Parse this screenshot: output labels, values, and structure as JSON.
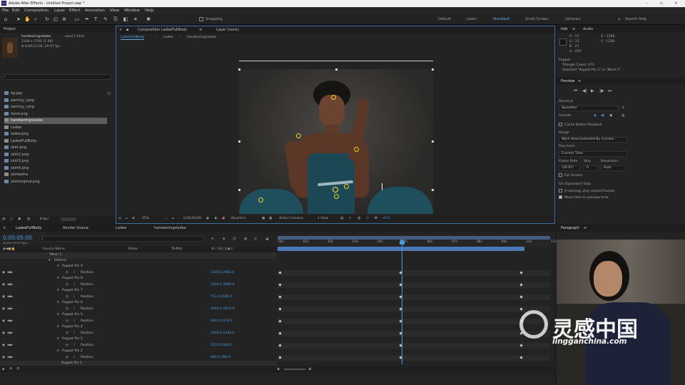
{
  "window": {
    "title": "Adobe After Effects - Untitled Project.aep *"
  },
  "menu": [
    "File",
    "Edit",
    "Composition",
    "Layer",
    "Effect",
    "Animation",
    "View",
    "Window",
    "Help"
  ],
  "toolbar": {
    "snapping": "Snapping",
    "workspaces": [
      "Default",
      "Learn",
      "Standard",
      "Small Screen",
      "Libraries"
    ],
    "search": "Search Help"
  },
  "project": {
    "tab": "Project",
    "selected_name": "handeeringsladee",
    "selected_used": ", used 1 time",
    "selected_size": "2160 x 2700 (1.00)",
    "selected_duration": "Δ 0;00;11;00, 29.97 fps",
    "files": [
      "bg.jpg",
      "earring_l.png",
      "earring_r.png",
      "hend.png",
      "handeeringsladee",
      "Ladee",
      "ladee.png",
      "LadeeFullBody",
      "skirt.png",
      "skirt2.png",
      "skirt3.png",
      "skirt4.png",
      "skirtextra",
      "skirtoriginal.png"
    ],
    "bpc": "8 bpc"
  },
  "composition": {
    "tab": "Composition LadeeFullBody",
    "layer_tab": "Layer (none)",
    "breadcrumbs": [
      "LadeeFullBody",
      "Ladee",
      "handeeringsladee"
    ],
    "zoom": "25%",
    "timecode": "0;00;05;00",
    "resolution": "(Quarter)",
    "camera": "Active Camera",
    "views": "1 View",
    "exposure": "+0.0"
  },
  "info": {
    "tab": "Info",
    "audio_tab": "Audio",
    "r": "R : 17",
    "g": "G : 21",
    "b": "B : 27",
    "a": "A : 255",
    "x": "X : 1184",
    "y": "Y : 1228",
    "puppet_title": "Puppet",
    "triangle": "Triangle Count: 672",
    "selected": "Selected \"Puppet Pin 1\" in \"Mesh 1\""
  },
  "preview": {
    "tab": "Preview",
    "shortcut_label": "Shortcut",
    "shortcut_value": "Spacebar",
    "include_label": "Include:",
    "cache": "Cache Before Playback",
    "range_label": "Range",
    "range_value": "Work Area Extended By Current...",
    "play_from_label": "Play From",
    "play_from_value": "Current Time",
    "frame_rate_label": "Frame Rate",
    "skip_label": "Skip",
    "resolution_label": "Resolution",
    "frame_rate_value": "(29.97)",
    "skip_value": "0",
    "resolution_value": "Auto",
    "full_screen": "Full Screen",
    "on_stop": "On (Spacebar) Stop",
    "if_caching": "If caching, play cached frames",
    "move_time": "Move time to preview time"
  },
  "paragraph": {
    "tab": "Paragraph"
  },
  "timeline": {
    "tabs": [
      "LadeeFullBody",
      "Render Queue",
      "Ladee",
      "handeeringsladee"
    ],
    "timecode": "0;00;05;00",
    "timecode_sub": "00150 (29.97 fps)",
    "col_source": "Source Name",
    "col_mode": "Mode",
    "col_trkmat": "TrkMat",
    "mesh": "Mesh 1",
    "deform": "Deform",
    "ruler": [
      "00s",
      "01s",
      "02s",
      "03s",
      "04s",
      "05s",
      "06s",
      "07s",
      "08s",
      "09s",
      "10s",
      "11s"
    ],
    "pins": [
      {
        "name": "Puppet Pin 9",
        "prop": "Position",
        "value": "1140.0,2683.0"
      },
      {
        "name": "Puppet Pin 8",
        "prop": "Position",
        "value": "2140.0,2690.0"
      },
      {
        "name": "Puppet Pin 7",
        "prop": "Position",
        "value": "753.0,2685.0"
      },
      {
        "name": "Puppet Pin 6",
        "prop": "Position",
        "value": "2040.0,1670.0"
      },
      {
        "name": "Puppet Pin 5",
        "prop": "Position",
        "value": "540.0,1470.0"
      },
      {
        "name": "Puppet Pin 4",
        "prop": "Position",
        "value": "1060.0,1430.0"
      },
      {
        "name": "Puppet Pin 3",
        "prop": "Position",
        "value": "1510.0,904.0"
      },
      {
        "name": "Puppet Pin 2",
        "prop": "Position",
        "value": "666.0,780.0"
      }
    ],
    "last_pin": "Puppet Pin 1",
    "playhead_fraction": 0.4545
  },
  "watermark": {
    "brand": "灵感中国",
    "site": "lingganchina.com"
  },
  "colors": {
    "accent": "#4a9ae0",
    "pin": "#f3d21c",
    "teal": "#1f4f5c"
  }
}
